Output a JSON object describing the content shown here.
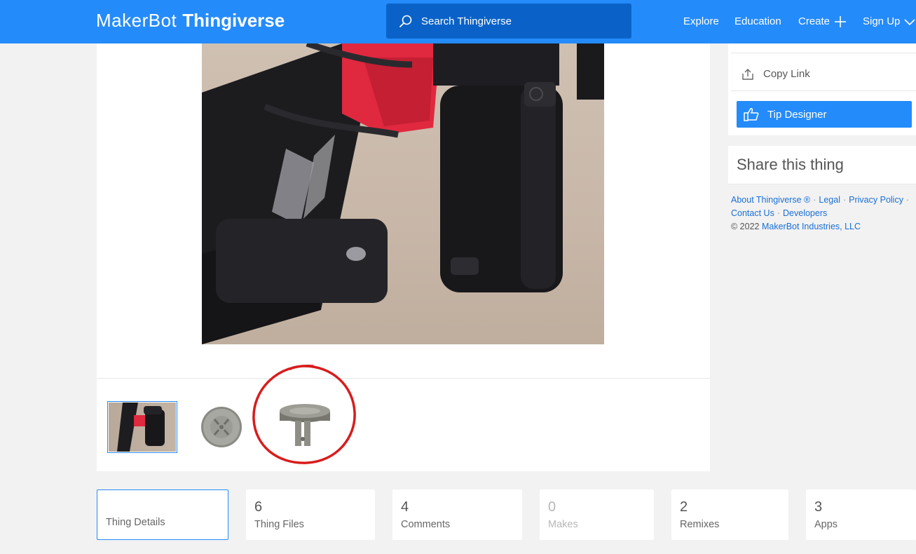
{
  "header": {
    "brand": "MakerBot",
    "product": "Thingiverse",
    "search_placeholder": "Search Thingiverse",
    "nav": {
      "explore": "Explore",
      "education": "Education",
      "create": "Create",
      "signup": "Sign Up"
    }
  },
  "sidebar": {
    "copy_link": "Copy Link",
    "tip_designer": "Tip Designer",
    "share_title": "Share this thing"
  },
  "footer": {
    "about": "About Thingiverse ®",
    "legal": "Legal",
    "privacy": "Privacy Policy",
    "contact": "Contact Us",
    "developers": "Developers",
    "copyright_prefix": "© 2022",
    "company": "MakerBot Industries, LLC"
  },
  "stats": {
    "details_label": "Thing Details",
    "files": {
      "count": "6",
      "label": "Thing Files"
    },
    "comments": {
      "count": "4",
      "label": "Comments"
    },
    "makes": {
      "count": "0",
      "label": "Makes"
    },
    "remixes": {
      "count": "2",
      "label": "Remixes"
    },
    "apps": {
      "count": "3",
      "label": "Apps"
    }
  },
  "colors": {
    "brand_blue": "#248bfb",
    "search_bg": "#0a62c8",
    "annotation_red": "#d81c1c"
  },
  "icons": {
    "search": "search-icon",
    "create": "plus-icon",
    "signup": "chevron-down-icon",
    "copy_link": "share-upload-icon",
    "tip": "thumbs-up-icon"
  }
}
